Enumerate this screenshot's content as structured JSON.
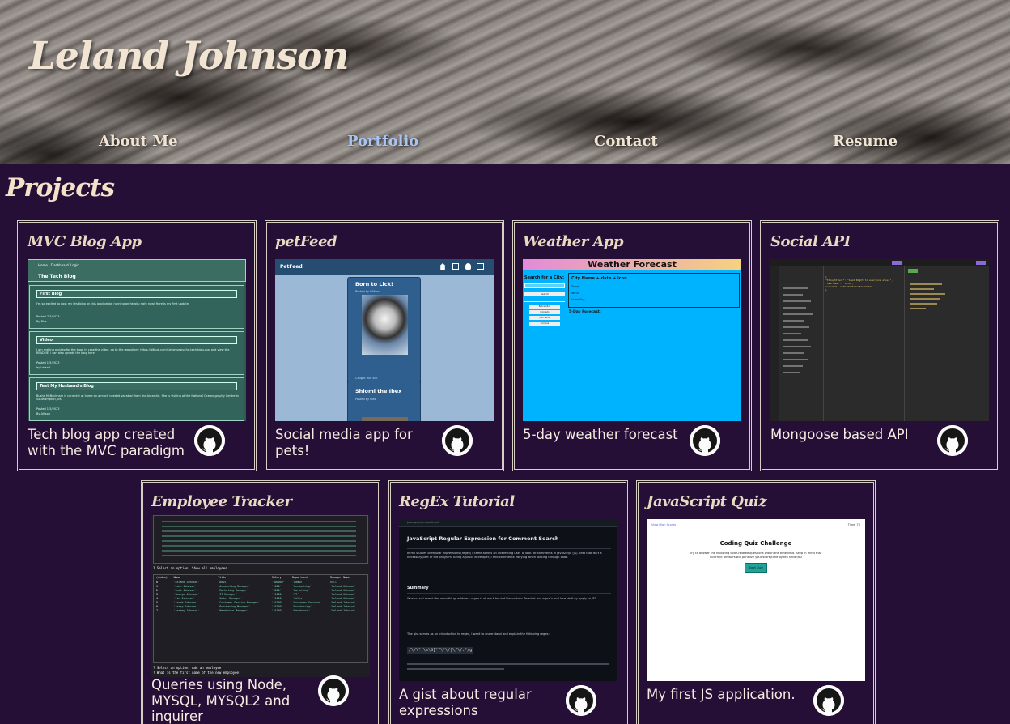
{
  "header": {
    "name": "Leland Johnson",
    "nav": [
      {
        "label": "About Me",
        "active": false
      },
      {
        "label": "Portfolio",
        "active": true
      },
      {
        "label": "Contact",
        "active": false
      },
      {
        "label": "Resume",
        "active": false
      }
    ]
  },
  "section_title": "Projects",
  "projects": [
    {
      "title": "MVC Blog App",
      "description": "Tech blog app created with the MVC paradigm",
      "icon": "github-icon",
      "screenshot": {
        "nav": [
          "Home",
          "Dashboard",
          "Login"
        ],
        "heading": "The Tech Blog",
        "posts": [
          {
            "title": "First Blog",
            "body": "I'm so excited to post my first blog on this application running on heroku right now! Here is my first update!",
            "meta": "Posted 7/3/2023",
            "author": "By Plus"
          },
          {
            "title": "Video",
            "body": "I am making a video for the blog. In case the video, go to the repository: https://github.com/sleepyoasis/the-tech-blog-app and view the README. I can also update the blog here.",
            "meta": "Posted 1/5/2023",
            "author": "by Leland"
          },
          {
            "title": "Test My Husband's Blog",
            "body": "Busha McBeckham is currently at home on a much needed vacation from the Antarctic. She is visiting at the National Oceanography Centre in Southampton, UK",
            "meta": "Posted 1/5/2023",
            "author": "By Allison"
          }
        ]
      }
    },
    {
      "title": "petFeed",
      "description": "Social media app for pets!",
      "icon": "github-icon",
      "screenshot": {
        "brand": "PetFeed",
        "posts": [
          {
            "title": "Born to Lick!",
            "by": "Posted by Willow",
            "caption": "Caught mid lick"
          },
          {
            "title": "Shlomi the Ibex",
            "by": "Posted by Ibex"
          }
        ]
      }
    },
    {
      "title": "Weather App",
      "description": "5-day weather forecast",
      "icon": "github-icon",
      "screenshot": {
        "banner": "Weather Forecast",
        "search_label": "Search for a City:",
        "search_button": "Search",
        "cities": [
          "Bolinas Bay",
          "Colorado",
          "Palo Verde",
          "Cordova"
        ],
        "current": "City Name + date + icon",
        "current_fields": [
          "Temp:",
          "Wind:",
          "Humidity:"
        ],
        "forecast_label": "5-Day Forecast:"
      }
    },
    {
      "title": "Social API",
      "description": "Mongoose based API",
      "icon": "github-icon",
      "screenshot": {
        "code": [
          "{",
          "  \"thoughtText\": \"Good Night to everyone else!\",",
          "  \"username\": \"lolo\",",
          "  \"userId\": \"64b4f7c0e9ea81e9da64\"",
          "}"
        ]
      }
    },
    {
      "title": "Employee Tracker",
      "description": "Queries using Node, MYSQL, MYSQL2 and inquirer",
      "icon": "github-icon",
      "screenshot": {
        "prompts": [
          "? Select an option. Show all employees",
          "? Select an option. Add an employee",
          "? What is the first name of the new employee?"
        ],
        "columns": [
          "(index)",
          "Name",
          "Title",
          "Salary",
          "Department",
          "Manager Name"
        ],
        "rows": [
          [
            "0",
            "'Leland Johnson'",
            "'Boss'",
            "'400000'",
            "'Admin'",
            "null"
          ],
          [
            "1",
            "'John Johnson'",
            "'Accounting Manager'",
            "'2000'",
            "'Accounting'",
            "'Leland Johnson'"
          ],
          [
            "2",
            "'Jack Johnson'",
            "'Marketing Manager'",
            "'3000'",
            "'Marketing'",
            "'Leland Johnson'"
          ],
          [
            "3",
            "'George Johnson'",
            "'IT Manager'",
            "'21000'",
            "'IT'",
            "'Leland Johnson'"
          ],
          [
            "4",
            "'Jim Johnson'",
            "'Sales Manager'",
            "'21000'",
            "'Sales'",
            "'Leland Johnson'"
          ],
          [
            "5",
            "'Jacob Johnson'",
            "'Customer Service Manager'",
            "'21000'",
            "'Customer Service'",
            "'Leland Johnson'"
          ],
          [
            "6",
            "'Jerry Johnson'",
            "'Purchasing Manager'",
            "'21000'",
            "'Purchasing'",
            "'Leland Johnson'"
          ],
          [
            "7",
            "'Jeremy Johnson'",
            "'Warehouse Manager'",
            "'21000'",
            "'Warehouse'",
            "'Leland Johnson'"
          ]
        ]
      }
    },
    {
      "title": "RegEx Tutorial",
      "description": "A gist about regular expressions",
      "icon": "github-icon",
      "screenshot": {
        "tab": "js-regex-comment.md",
        "heading": "JavaScript Regular Expression for Comment Search",
        "intro": "In my studies of regular expressions (regex) I came across an interesting use. To look for comments in JavaScript (JS). Text that isn't a necessary part of the program. Being a junior developer, I find comments edifying when looking through code.",
        "summary_heading": "Summary",
        "summary": "Whenever I search for something, odds are regex is at work behind the curtain. So what are regex's and how do they apply to JS?",
        "gist": "The gist serves as an introduction to regex, I want to understand and explain the following regex:",
        "regex": "/\\/\\*[\\s\\S]*?\\*\\/|\\/\\/.*/g"
      }
    },
    {
      "title": "JavaScript Quiz",
      "description": "My first JS application.",
      "icon": "github-icon",
      "screenshot": {
        "top_left": "View High Scores",
        "top_right": "Time: 75",
        "heading": "Coding Quiz Challenge",
        "body": "Try to answer the following code-related questions within the time limit. Keep in mind that incorrect answers will penalize your score/time by ten seconds!",
        "button": "Start Quiz"
      }
    }
  ],
  "colors": {
    "background": "#250f36",
    "nav_active": "#a9c4f0",
    "text": "#f1e4d2",
    "card_border": "#d8cfc4"
  }
}
